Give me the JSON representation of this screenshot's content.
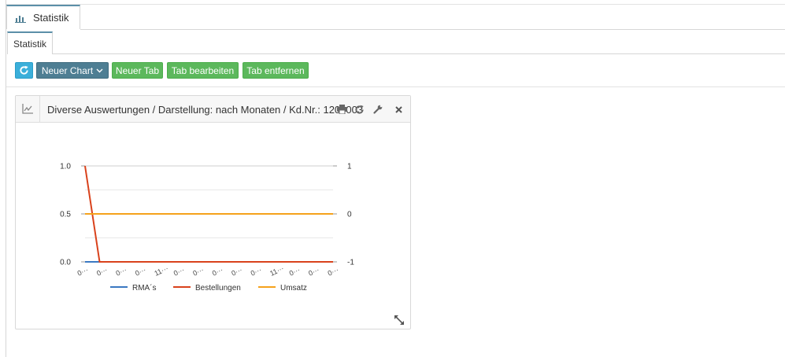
{
  "main_tab": {
    "label": "Statistik"
  },
  "sub_tab": {
    "label": "Statistik"
  },
  "toolbar": {
    "new_chart": "Neuer Chart",
    "new_tab": "Neuer Tab",
    "edit_tab": "Tab bearbeiten",
    "remove_tab": "Tab entfernen"
  },
  "panel": {
    "title": "Diverse Auswertungen / Darstellung: nach Monaten / Kd.Nr.: 1200003"
  },
  "colors": {
    "rma": "#3a78c2",
    "bestellungen": "#d9421c",
    "umsatz": "#f5a21b",
    "refresh_button": "#3bafda",
    "chart_button": "#4e7e93",
    "green_button": "#5cb85c",
    "tab_accent": "#5b8fa8"
  },
  "chart_data": {
    "type": "line",
    "x_tick_labels": [
      "0···",
      "0···",
      "0···",
      "0···",
      "11···",
      "0···",
      "0···",
      "0···",
      "0···",
      "0···",
      "11···",
      "0···",
      "0···",
      "0···"
    ],
    "left_axis": {
      "ticks": [
        "1.0",
        "0.5",
        "0.0"
      ],
      "ylim": [
        0,
        1
      ]
    },
    "right_axis": {
      "ticks": [
        "1",
        "0",
        "-1"
      ],
      "ylim": [
        -1,
        1
      ]
    },
    "grid": true,
    "legend_position": "bottom",
    "series": [
      {
        "name": "RMA´s",
        "axis": "left",
        "color": "#3a78c2",
        "values": [
          0,
          0,
          0,
          0,
          0,
          0,
          0,
          0,
          0,
          0,
          0,
          0,
          0,
          0,
          0,
          0,
          0,
          0
        ]
      },
      {
        "name": "Bestellungen",
        "axis": "left",
        "color": "#d9421c",
        "values": [
          1,
          0,
          0,
          0,
          0,
          0,
          0,
          0,
          0,
          0,
          0,
          0,
          0,
          0,
          0,
          0,
          0,
          0
        ]
      },
      {
        "name": "Umsatz",
        "axis": "right",
        "color": "#f5a21b",
        "values": [
          0,
          0,
          0,
          0,
          0,
          0,
          0,
          0,
          0,
          0,
          0,
          0,
          0,
          0,
          0,
          0,
          0,
          0
        ]
      }
    ]
  }
}
